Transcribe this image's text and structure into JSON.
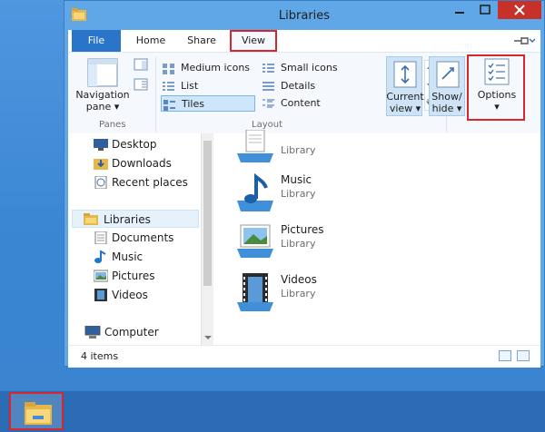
{
  "window": {
    "title": "Libraries"
  },
  "ribbon_tabs": {
    "file": "File",
    "home": "Home",
    "share": "Share",
    "view": "View"
  },
  "ribbon": {
    "panes": {
      "navigation_pane_line1": "Navigation",
      "navigation_pane_line2": "pane",
      "group_label": "Panes"
    },
    "layout": {
      "items": [
        "Medium icons",
        "Small icons",
        "List",
        "Details",
        "Tiles",
        "Content"
      ],
      "selected": "Tiles",
      "group_label": "Layout"
    },
    "current_view": {
      "line1": "Current",
      "line2": "view"
    },
    "show_hide": {
      "line1": "Show/",
      "line2": "hide"
    },
    "options": {
      "label": "Options"
    }
  },
  "nav": {
    "items": [
      "Desktop",
      "Downloads",
      "Recent places",
      "Libraries",
      "Documents",
      "Music",
      "Pictures",
      "Videos",
      "Computer"
    ],
    "selected": "Libraries"
  },
  "tiles": [
    {
      "name": "",
      "sub": "Library"
    },
    {
      "name": "Music",
      "sub": "Library"
    },
    {
      "name": "Pictures",
      "sub": "Library"
    },
    {
      "name": "Videos",
      "sub": "Library"
    }
  ],
  "status": {
    "count": "4 items"
  },
  "colors": {
    "accent": "#2a74c9",
    "highlight_red": "#d9262c",
    "selected": "#cde6fb"
  }
}
